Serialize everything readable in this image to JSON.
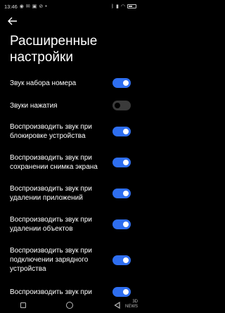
{
  "status": {
    "time": "13:46",
    "left_icons": [
      "chat-icon",
      "mail-icon",
      "gallery-icon",
      "block-icon",
      "more-icon"
    ],
    "right_icons": [
      "bluetooth-icon",
      "signal-icon",
      "wifi-icon",
      "battery-icon"
    ]
  },
  "header": {
    "back_icon": "arrow-left-icon",
    "title_line1": "Расширенные",
    "title_line2": "настройки"
  },
  "settings": [
    {
      "label": "Звук набора номера",
      "on": true
    },
    {
      "label": "Звуки нажатия",
      "on": false
    },
    {
      "label": "Воспроизводить звук при блокировке устройства",
      "on": true
    },
    {
      "label": "Воспроизводить звук при сохранении снимка экрана",
      "on": true
    },
    {
      "label": "Воспроизводить звук при удалении приложений",
      "on": true
    },
    {
      "label": "Воспроизводить звук при удалении объектов",
      "on": true
    },
    {
      "label": "Воспроизводить звук при подключении зарядного устройства",
      "on": true
    },
    {
      "label": "Воспроизводить звук при",
      "on": true
    }
  ],
  "colors": {
    "accent": "#2e6ef0",
    "background": "#000000",
    "off_track": "#3a3a3a"
  },
  "navbar": {
    "icons": [
      "recents-icon",
      "home-icon",
      "back-icon"
    ]
  },
  "watermark": {
    "line1": "3D",
    "line2": "NEWS"
  }
}
